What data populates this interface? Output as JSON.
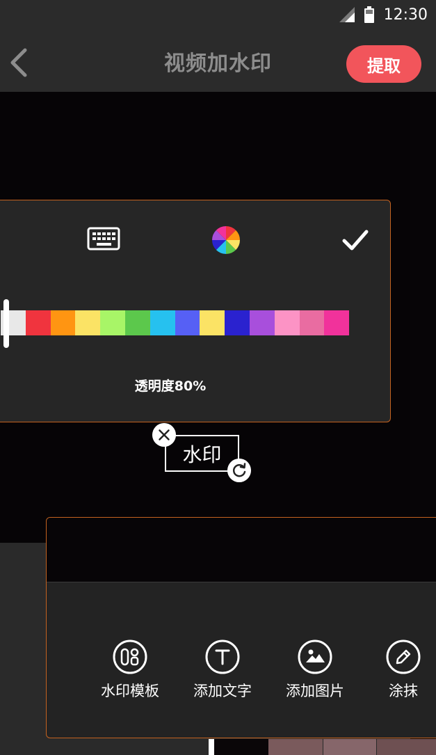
{
  "status_bar": {
    "time": "12:30"
  },
  "header": {
    "title": "视频加水印",
    "extract_label": "提取"
  },
  "color_panel": {
    "palette": [
      "#e8e8e8",
      "#f0343e",
      "#ff9512",
      "#fbe365",
      "#a8f567",
      "#5cc84c",
      "#26c1ef",
      "#5660f5",
      "#fbe365",
      "#2a22cf",
      "#a84fdc",
      "#fc93c5",
      "#e96ca1",
      "#f1329b"
    ],
    "selected_color": "#e8e8e8",
    "opacity_label": "透明度80%",
    "opacity": 0.8
  },
  "watermark": {
    "text": "水印"
  },
  "tools": [
    {
      "icon": "template-icon",
      "label": "水印模板"
    },
    {
      "icon": "text-icon",
      "label": "添加文字"
    },
    {
      "icon": "image-icon",
      "label": "添加图片"
    },
    {
      "icon": "brush-icon",
      "label": "涂抹"
    }
  ],
  "colors": {
    "accent": "#f2555b",
    "panel_border": "#c4621f",
    "panel_bg": "#262626",
    "video_bg": "#060406"
  }
}
